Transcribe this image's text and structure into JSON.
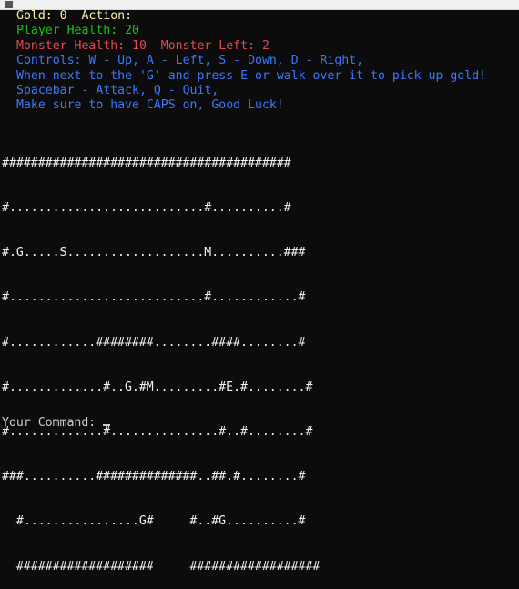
{
  "status": {
    "gold_line": "Gold: 0  Action:",
    "player_health": "Player Health: 20",
    "monster_line": "Monster Health: 10  Monster Left: 2",
    "controls": "Controls: W - Up, A - Left, S - Down, D - Right,",
    "gold_hint": "When next to the 'G' and press E or walk over it to pick up gold!",
    "attack_quit": "Spacebar - Attack, Q - Quit,",
    "caps_hint": "Make sure to have CAPS on, Good Luck!"
  },
  "map": {
    "rows": [
      "########################################",
      "#...........................#..........#",
      "#.G.....S...................M..........###",
      "#...........................#............#",
      "#............########........####........#",
      "#.............#..G.#M.........#E.#........#",
      "#.............#...............#..#........#",
      "###..........##############..##.#........#",
      "  #................G#     #..#G..........#",
      "  ###################     ##################"
    ]
  },
  "prompt": {
    "label": "Your Command: "
  },
  "colors": {
    "background": "#0c0c0c",
    "yellow": "#f9f1a5",
    "green": "#16c60c",
    "red": "#e74856",
    "blue": "#3b78ff",
    "map_text": "#f2f2f2"
  }
}
